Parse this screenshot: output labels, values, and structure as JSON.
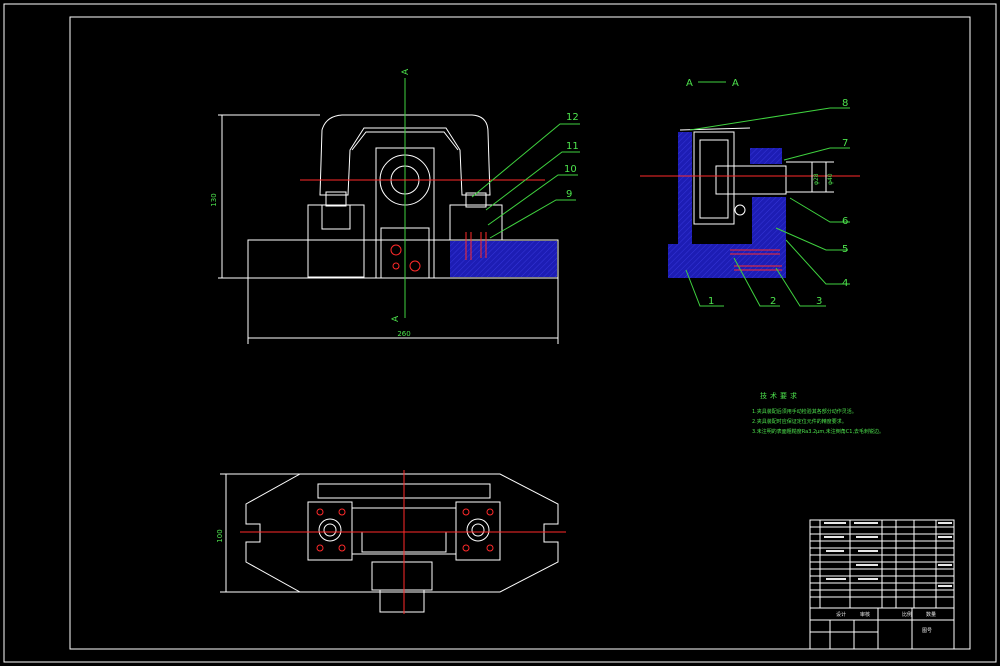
{
  "section_view": {
    "title_left": "A",
    "title_right": "A"
  },
  "section_markers": {
    "top": "A",
    "bottom": "A"
  },
  "front_view": {
    "dim_width": "260",
    "dim_height": "130",
    "balloons": [
      "12",
      "11",
      "10",
      "9"
    ]
  },
  "top_view": {
    "dim_height": "100"
  },
  "section_balloons": [
    "8",
    "7",
    "6",
    "5",
    "4",
    "3",
    "2",
    "1"
  ],
  "side_dims": [
    "φ28",
    "φ40"
  ],
  "tech_requirements": {
    "title": "技术要求",
    "lines": [
      "1.夹具装配后须用手动检验其各部分动作灵活。",
      "2.夹具装配时应保证定位元件的精度要求。",
      "3.未注明的表面粗糙度Ra3.2μm,未注倒角C1,去毛刺锐边。"
    ]
  },
  "title_block": {
    "designed": "设计",
    "checked": "审核",
    "scale": "比例",
    "qty": "数量",
    "drawing_no": "图号"
  },
  "colors": {
    "border": "#ffffff",
    "centerline": "#ff2a2a",
    "dimension": "#3fd23f",
    "solid": "#1d1db4",
    "annotation": "#4de34d"
  }
}
